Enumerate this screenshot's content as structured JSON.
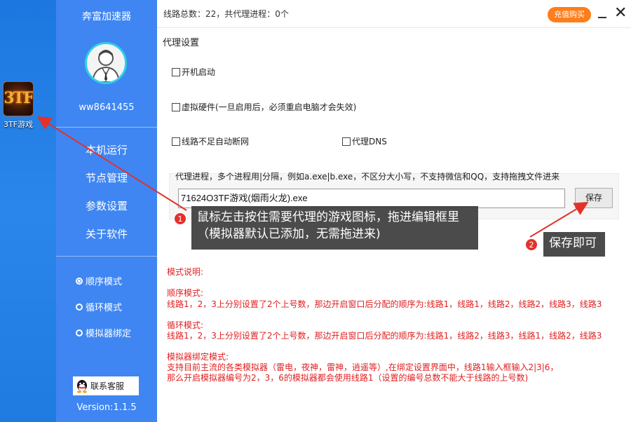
{
  "desktop": {
    "icon_label": "3TF游戏",
    "icon_logo": "3TF"
  },
  "sidebar": {
    "app_title": "奔富加速器",
    "username": "ww8641455",
    "nav": [
      "本机运行",
      "节点管理",
      "参数设置",
      "关于软件"
    ],
    "modes": [
      {
        "label": "顺序模式",
        "selected": true
      },
      {
        "label": "循环模式",
        "selected": false
      },
      {
        "label": "模拟器绑定",
        "selected": false
      }
    ],
    "service_label": "联系客服",
    "version": "Version:1.1.5"
  },
  "topbar": {
    "route_info": "线路总数：22，共代理进程：0个",
    "recharge_label": "充值购买",
    "close_label": "✕"
  },
  "settings": {
    "section_title": "代理设置",
    "options": {
      "autostart": {
        "label": "开机启动",
        "checked": false
      },
      "virtual_hw": {
        "label": "虚拟硬件(一旦启用后，必须重启电脑才会失效)",
        "checked": false
      },
      "auto_disconnect": {
        "label": "线路不足自动断网",
        "checked": false
      },
      "proxy_dns": {
        "label": "代理DNS",
        "checked": false
      }
    },
    "proxy_label": "代理进程，多个进程用|分隔，例如a.exe|b.exe，不区分大小写，不支持微信和QQ，支持拖拽文件进来",
    "proxy_value": "71624O3TF游戏(烟雨火龙).exe",
    "save_label": "保存"
  },
  "explanation": {
    "heading": "模式说明:",
    "seq_title": "顺序模式:",
    "seq_text": "线路1，2，3上分别设置了2个上号数，那边开启窗口后分配的顺序为:线路1，线路1，线路2，线路2，线路3，线路3",
    "loop_title": "循环模式:",
    "loop_text": "线路1，2，3上分别设置了2个上号数，那边开启窗口后分配的顺序为:线路1，线路2，线路3，线路1，线路2，线路3",
    "emu_title": "模拟器绑定模式:",
    "emu_text1": "支持目前主流的各类模拟器（雷电，夜神，雷神，逍遥等）,在绑定设置界面中，线路1输入框输入2|3|6，",
    "emu_text2": "那么开启模拟器编号为2，3，6的模拟器都会使用线路1（设置的编号总数不能大于线路的上号数)"
  },
  "annotations": {
    "badge1": "1",
    "tip1_line1": "鼠标左击按住需要代理的游戏图标，拖进编辑框里",
    "tip1_line2": "（模拟器默认已添加，无需拖进来)",
    "badge2": "2",
    "tip2": "保存即可"
  },
  "colors": {
    "sidebar": "#3f86f2",
    "desktop": "#1f7be0",
    "recharge": "#ff7d1a",
    "explanation_text": "#e02020",
    "annotation_arrow": "#e3312a",
    "avatar_ring": "#2fd0e6"
  }
}
